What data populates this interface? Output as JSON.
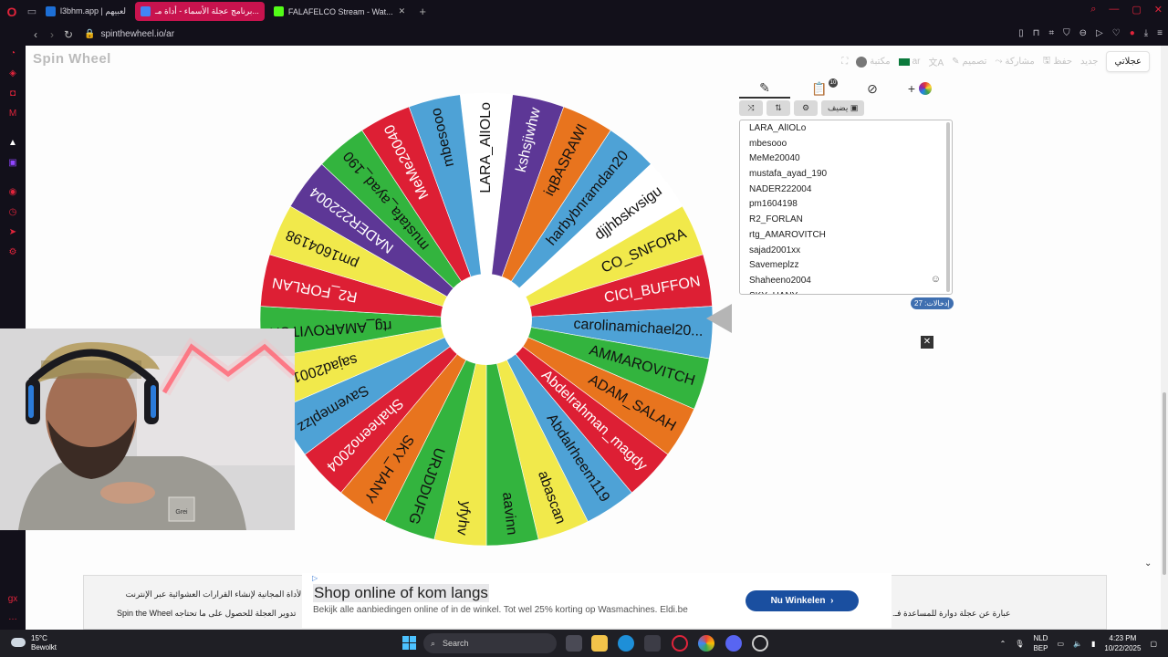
{
  "browser": {
    "tabs": [
      {
        "label": "l3bhm.app | لعبيهم",
        "favicon_color": "#1d6fd6",
        "active": false
      },
      {
        "label": "برنامج عجلة الأسماء - أداة مـ...",
        "favicon_color": "#4285f4",
        "active": true
      },
      {
        "label": "FALAFELCO Stream - Wat...",
        "favicon_color": "#53fc18",
        "active": false
      }
    ],
    "url": "spinthewheel.io/ar"
  },
  "site": {
    "logo": "Spin Wheel",
    "nav": {
      "new": "جديد",
      "save": "حفظ",
      "share": "مشاركة",
      "design": "تصميم",
      "lang": "ar",
      "gallery": "مكتبة",
      "urgent": "عجلاتي"
    }
  },
  "wheel": {
    "slices": [
      {
        "name": "LARA_AlIOLo",
        "color": "#ffffff",
        "text": "#111111"
      },
      {
        "name": "kshsjiwhw",
        "color": "#5d3796",
        "text": "#ffffff"
      },
      {
        "name": "iqBASRAWI",
        "color": "#e8741e",
        "text": "#111111"
      },
      {
        "name": "harbybnramdan20",
        "color": "#4ea2d6",
        "text": "#111111"
      },
      {
        "name": "djjhbskvsigu",
        "color": "#ffffff",
        "text": "#111111"
      },
      {
        "name": "CO_SNFORA",
        "color": "#f1e94b",
        "text": "#111111"
      },
      {
        "name": "CICI_BUFFON",
        "color": "#dd1f34",
        "text": "#ffffff"
      },
      {
        "name": "carolinamichael20...",
        "color": "#4ea2d6",
        "text": "#111111"
      },
      {
        "name": "AMMAROVITCH",
        "color": "#33b43e",
        "text": "#111111"
      },
      {
        "name": "ADAM_SALAH",
        "color": "#e8741e",
        "text": "#111111"
      },
      {
        "name": "Abdelrahman_magdy",
        "color": "#dd1f34",
        "text": "#ffffff"
      },
      {
        "name": "Abdalrheem119",
        "color": "#4ea2d6",
        "text": "#111111"
      },
      {
        "name": "abascan",
        "color": "#f1e94b",
        "text": "#111111"
      },
      {
        "name": "aavinn",
        "color": "#33b43e",
        "text": "#111111"
      },
      {
        "name": "yfyhv",
        "color": "#f1e94b",
        "text": "#111111"
      },
      {
        "name": "URJDDUFG",
        "color": "#33b43e",
        "text": "#111111"
      },
      {
        "name": "SKY_HANY",
        "color": "#e8741e",
        "text": "#111111"
      },
      {
        "name": "Shaheeno2004",
        "color": "#dd1f34",
        "text": "#ffffff"
      },
      {
        "name": "Savemeplzz",
        "color": "#4ea2d6",
        "text": "#111111"
      },
      {
        "name": "sajad2001xx",
        "color": "#f1e94b",
        "text": "#111111"
      },
      {
        "name": "rtg_AMAROVITCH",
        "color": "#33b43e",
        "text": "#111111"
      },
      {
        "name": "R2_FORLAN",
        "color": "#dd1f34",
        "text": "#ffffff"
      },
      {
        "name": "pm1604198",
        "color": "#f1e94b",
        "text": "#111111"
      },
      {
        "name": "NADER222004",
        "color": "#5d3796",
        "text": "#ffffff"
      },
      {
        "name": "mustafa_ayad_190",
        "color": "#33b43e",
        "text": "#111111"
      },
      {
        "name": "MeMe20040",
        "color": "#dd1f34",
        "text": "#ffffff"
      },
      {
        "name": "mbesooo",
        "color": "#4ea2d6",
        "text": "#111111"
      }
    ]
  },
  "panel": {
    "add_button": "يضيف",
    "entries": [
      "LARA_AlIOLo",
      "mbesooo",
      "MeMe20040",
      "mustafa_ayad_190",
      "NADER222004",
      "pm1604198",
      "R2_FORLAN",
      "rtg_AMAROVITCH",
      "sajad2001xx",
      "Savemeplzz",
      "Shaheeno2004",
      "SKY_HANY"
    ],
    "count": "إدخالات: 27",
    "badge": "10"
  },
  "ad": {
    "title": "Shop online of kom langs",
    "desc": "Bekijk alle aanbiedingen online of in de winkel. Tot wel 25% korting op Wasmachines. Eldi.be",
    "cta": "Nu Winkelen",
    "bg_text_1": "ه الأداة المجانية لإنشاء القرارات العشوائية عبر الإنترنت",
    "bg_text_2": "Spin the Wheel  تدوير العجلة للحصول على ما تحتاجه",
    "bg_text_3": "عبارة عن عجلة دوارة للمساعدة فـ."
  },
  "taskbar": {
    "temp": "15°C",
    "weather": "Bewolkt",
    "search": "Search",
    "lang1": "NLD",
    "lang2": "BEP",
    "time": "4:23 PM",
    "date": "10/22/2025"
  },
  "webcam": {
    "cap_text": "Grei"
  }
}
